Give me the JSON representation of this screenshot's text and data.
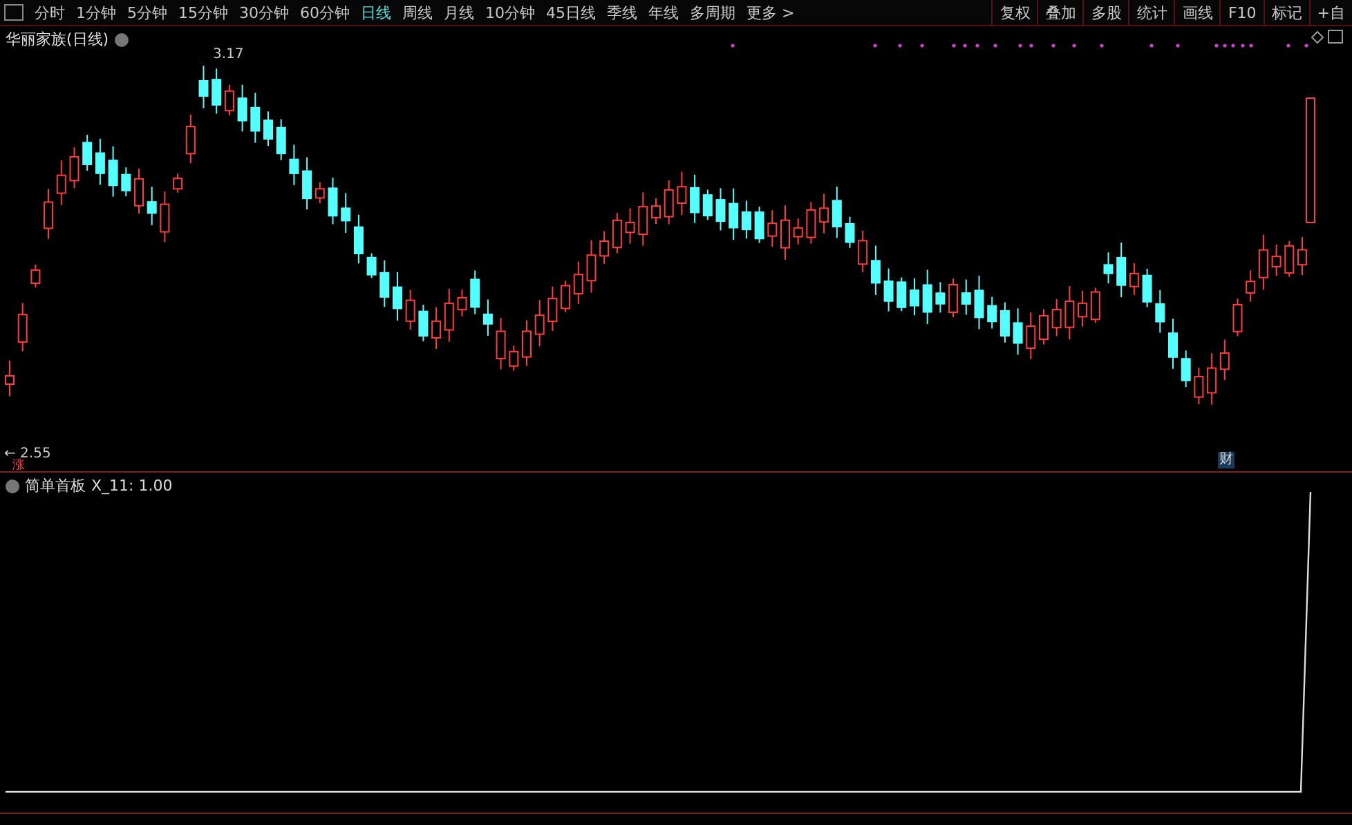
{
  "toolbar": {
    "periods": [
      {
        "label": "分时",
        "selected": false
      },
      {
        "label": "1分钟",
        "selected": false
      },
      {
        "label": "5分钟",
        "selected": false
      },
      {
        "label": "15分钟",
        "selected": false
      },
      {
        "label": "30分钟",
        "selected": false
      },
      {
        "label": "60分钟",
        "selected": false
      },
      {
        "label": "日线",
        "selected": true
      },
      {
        "label": "周线",
        "selected": false
      },
      {
        "label": "月线",
        "selected": false
      },
      {
        "label": "10分钟",
        "selected": false
      },
      {
        "label": "45日线",
        "selected": false
      },
      {
        "label": "季线",
        "selected": false
      },
      {
        "label": "年线",
        "selected": false
      },
      {
        "label": "多周期",
        "selected": false
      }
    ],
    "more": "更多 >",
    "tools": [
      "复权",
      "叠加",
      "多股",
      "统计",
      "画线",
      "F10",
      "标记",
      "+自"
    ]
  },
  "chart": {
    "title": "华丽家族(日线)",
    "high_label": "3.17",
    "low_label": "← 2.55",
    "rise_marker": "涨",
    "finance_marker": "财"
  },
  "indicator": {
    "name": "简单首板",
    "value": "X_11: 1.00"
  }
}
